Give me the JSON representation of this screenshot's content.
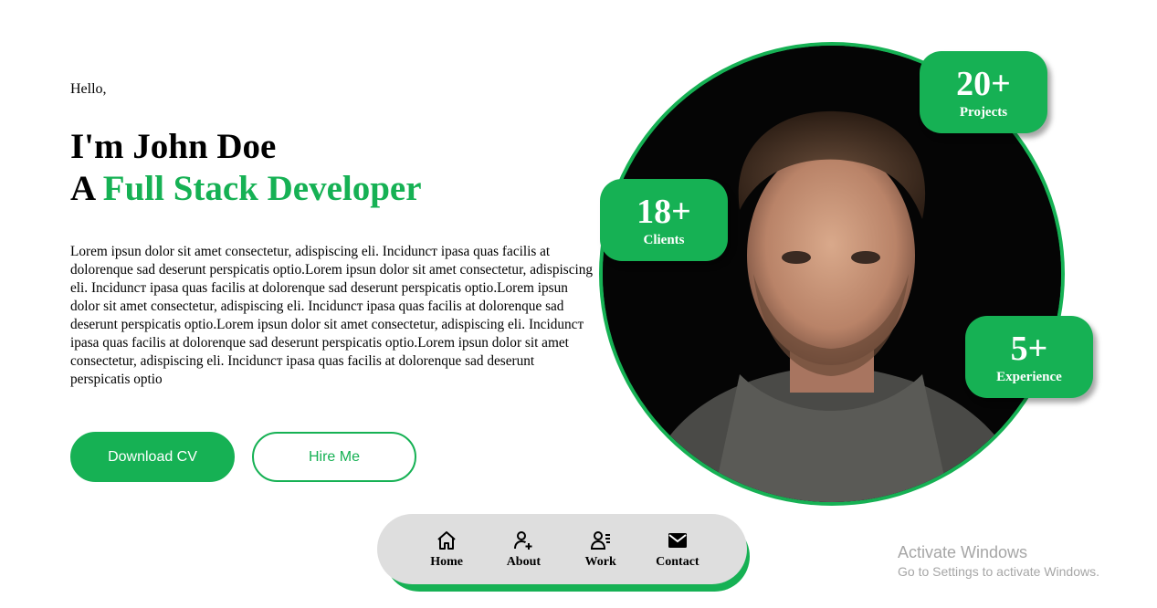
{
  "hero": {
    "greeting": "Hello,",
    "name_line": "I'm John Doe",
    "role_prefix": "A",
    "role_highlight": "Full Stack Developer",
    "description": "Lorem ipsun dolor sit amet consectetur, adispiscing eli. Inciduncт ipasa quas facilis at dolorenque sad deserunt perspicatis optio.Lorem ipsun dolor sit amet consectetur, adispiscing eli. Inciduncт ipasa quas facilis at dolorenque sad deserunt perspicatis optio.Lorem ipsun dolor sit amet consectetur, adispiscing eli. Inciduncт ipasa quas facilis at dolorenque sad deserunt perspicatis optio.Lorem ipsun dolor sit amet consectetur, adispiscing eli. Inciduncт ipasa quas facilis at dolorenque sad deserunt perspicatis optio.Lorem ipsun dolor sit amet consectetur, adispiscing eli. Inciduncт ipasa quas facilis at dolorenque sad deserunt perspicatis optio",
    "download_label": "Download CV",
    "hire_label": "Hire Me"
  },
  "stats": {
    "projects": {
      "value": "20+",
      "label": "Projects"
    },
    "clients": {
      "value": "18+",
      "label": "Clients"
    },
    "experience": {
      "value": "5+",
      "label": "Experience"
    }
  },
  "nav": {
    "items": [
      {
        "label": "Home",
        "icon": "home-icon"
      },
      {
        "label": "About",
        "icon": "user-plus-icon"
      },
      {
        "label": "Work",
        "icon": "user-list-icon"
      },
      {
        "label": "Contact",
        "icon": "mail-icon"
      }
    ]
  },
  "watermark": {
    "title": "Activate Windows",
    "subtitle": "Go to Settings to activate Windows."
  },
  "colors": {
    "accent": "#16b154",
    "nav_bg": "#dedede"
  }
}
